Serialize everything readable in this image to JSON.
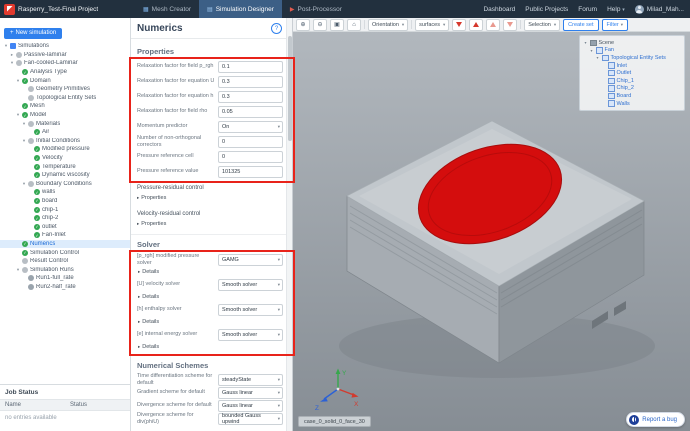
{
  "header": {
    "project_title": "Rasperry_Test-Final Project",
    "tabs": [
      {
        "label": "Mesh Creator"
      },
      {
        "label": "Simulation Designer"
      },
      {
        "label": "Post-Processor"
      }
    ],
    "nav": [
      "Dashboard",
      "Public Projects",
      "Forum",
      "Help"
    ],
    "user_name": "Milad_Mah..."
  },
  "icons": {
    "zoom_in": "⊕",
    "zoom_out": "⊖",
    "fit_view": "▣",
    "home_view": "⌂",
    "mesh_creator": "▦",
    "simulation_designer": "▤",
    "post_processor": "▶",
    "caret_down": "▾",
    "caret_right": "▸",
    "help": "?",
    "plus": "+",
    "check": "✓"
  },
  "sidebar": {
    "new_simulation_label": "New simulation",
    "tree": [
      {
        "label": "Simulations",
        "depth": 0,
        "caret": "down",
        "icon": "blue"
      },
      {
        "label": "Passive-laminar",
        "depth": 1,
        "caret": "right",
        "icon": "gray"
      },
      {
        "label": "Fan-cooled-Laminar",
        "depth": 1,
        "caret": "down",
        "icon": "gray"
      },
      {
        "label": "Analysis Type",
        "depth": 2,
        "icon": "check"
      },
      {
        "label": "Domain",
        "depth": 2,
        "caret": "down",
        "icon": "check"
      },
      {
        "label": "Geometry Primitives",
        "depth": 3,
        "icon": "gray"
      },
      {
        "label": "Topological Entity Sets",
        "depth": 3,
        "icon": "gray"
      },
      {
        "label": "Mesh",
        "depth": 2,
        "icon": "check"
      },
      {
        "label": "Model",
        "depth": 2,
        "caret": "down",
        "icon": "check"
      },
      {
        "label": "Materials",
        "depth": 3,
        "caret": "down",
        "icon": "gray"
      },
      {
        "label": "Air",
        "depth": 4,
        "icon": "check"
      },
      {
        "label": "Initial Conditions",
        "depth": 3,
        "caret": "down",
        "icon": "gray"
      },
      {
        "label": "Modified pressure",
        "depth": 4,
        "icon": "check"
      },
      {
        "label": "Velocity",
        "depth": 4,
        "icon": "check"
      },
      {
        "label": "Temperature",
        "depth": 4,
        "icon": "check"
      },
      {
        "label": "Dynamic viscosity",
        "depth": 4,
        "icon": "check"
      },
      {
        "label": "Boundary Conditions",
        "depth": 3,
        "caret": "down",
        "icon": "gray"
      },
      {
        "label": "walls",
        "depth": 4,
        "icon": "check"
      },
      {
        "label": "board",
        "depth": 4,
        "icon": "check"
      },
      {
        "label": "chip-1",
        "depth": 4,
        "icon": "check"
      },
      {
        "label": "chip-2",
        "depth": 4,
        "icon": "check"
      },
      {
        "label": "outlet",
        "depth": 4,
        "icon": "check"
      },
      {
        "label": "Fan-Inlet",
        "depth": 4,
        "icon": "check"
      },
      {
        "label": "Numerics",
        "depth": 2,
        "icon": "check",
        "active": true
      },
      {
        "label": "Simulation Control",
        "depth": 2,
        "icon": "check"
      },
      {
        "label": "Result Control",
        "depth": 2,
        "icon": "gray"
      },
      {
        "label": "Simulation Runs",
        "depth": 2,
        "caret": "down",
        "icon": "gray"
      },
      {
        "label": "Run1-full_rate",
        "depth": 3,
        "icon": "run"
      },
      {
        "label": "Run2-half_rate",
        "depth": 3,
        "icon": "run"
      }
    ],
    "job_status": {
      "title": "Job Status",
      "columns": [
        "Name",
        "Status"
      ],
      "empty_text": "no entries available"
    }
  },
  "panel": {
    "title": "Numerics",
    "properties": {
      "heading": "Properties",
      "fields": [
        {
          "label": "Relaxation factor for field p_rgh",
          "value": "0.1",
          "type": "input"
        },
        {
          "label": "Relaxation factor for equation U",
          "value": "0.3",
          "type": "input"
        },
        {
          "label": "Relaxation factor for equation h",
          "value": "0.3",
          "type": "input"
        },
        {
          "label": "Relaxation factor for field rho",
          "value": "0.05",
          "type": "input"
        },
        {
          "label": "Momentum predictor",
          "value": "On",
          "type": "select"
        },
        {
          "label": "Number of non-orthogonal correctors",
          "value": "0",
          "type": "input"
        },
        {
          "label": "Pressure reference cell",
          "value": "0",
          "type": "input"
        },
        {
          "label": "Pressure reference value",
          "value": "101325",
          "type": "input"
        }
      ]
    },
    "residual_controls": [
      {
        "label": "Pressure-residual control",
        "toggle": "Properties"
      },
      {
        "label": "Velocity-residual control",
        "toggle": "Properties"
      }
    ],
    "solver": {
      "heading": "Solver",
      "fields": [
        {
          "label": "[p_rgh] modified pressure solver",
          "value": "GAMG",
          "type": "select",
          "details": "Details"
        },
        {
          "label": "[U] velocity solver",
          "value": "Smooth solver",
          "type": "select",
          "details": "Details"
        },
        {
          "label": "[h] enthalpy solver",
          "value": "Smooth solver",
          "type": "select",
          "details": "Details"
        },
        {
          "label": "[e] internal energy solver",
          "value": "Smooth solver",
          "type": "select",
          "details": "Details"
        }
      ]
    },
    "schemes": {
      "heading": "Numerical Schemes",
      "fields": [
        {
          "label": "Time differentiation scheme for default",
          "value": "steadyState",
          "type": "select"
        },
        {
          "label": "Gradient scheme for default",
          "value": "Gauss linear",
          "type": "select"
        },
        {
          "label": "Divergence scheme for default",
          "value": "Gauss linear",
          "type": "select"
        },
        {
          "label": "Divergence scheme for div(phiU)",
          "value": "bounded Gauss upwind",
          "type": "select"
        }
      ]
    }
  },
  "viewport": {
    "toolbar": {
      "orientation_label": "Orientation",
      "render_mode_value": "surfaces",
      "selection_label": "Selection",
      "create_set_label": "Create set",
      "filter_label": "Filter"
    },
    "scene_tree": [
      {
        "label": "Scene",
        "depth": 0,
        "root": true,
        "caret": "down"
      },
      {
        "label": "Fan",
        "depth": 1,
        "caret": "down"
      },
      {
        "label": "Topological Entity Sets",
        "depth": 2,
        "caret": "down"
      },
      {
        "label": "Inlet",
        "depth": 3
      },
      {
        "label": "Outlet",
        "depth": 3
      },
      {
        "label": "Chip_1",
        "depth": 3
      },
      {
        "label": "Chip_2",
        "depth": 3
      },
      {
        "label": "Board",
        "depth": 3
      },
      {
        "label": "Walls",
        "depth": 3
      }
    ],
    "axis": {
      "x": "X",
      "y": "Y",
      "z": "Z"
    },
    "selection_label": "case_0_solid_0_face_30",
    "report_bug_label": "Report a bug"
  },
  "colors": {
    "accent": "#2f80ed",
    "annotation": "#e8231a",
    "fan_red": "#d40d0d",
    "check_green": "#34a853",
    "header_bg": "#22303e"
  }
}
